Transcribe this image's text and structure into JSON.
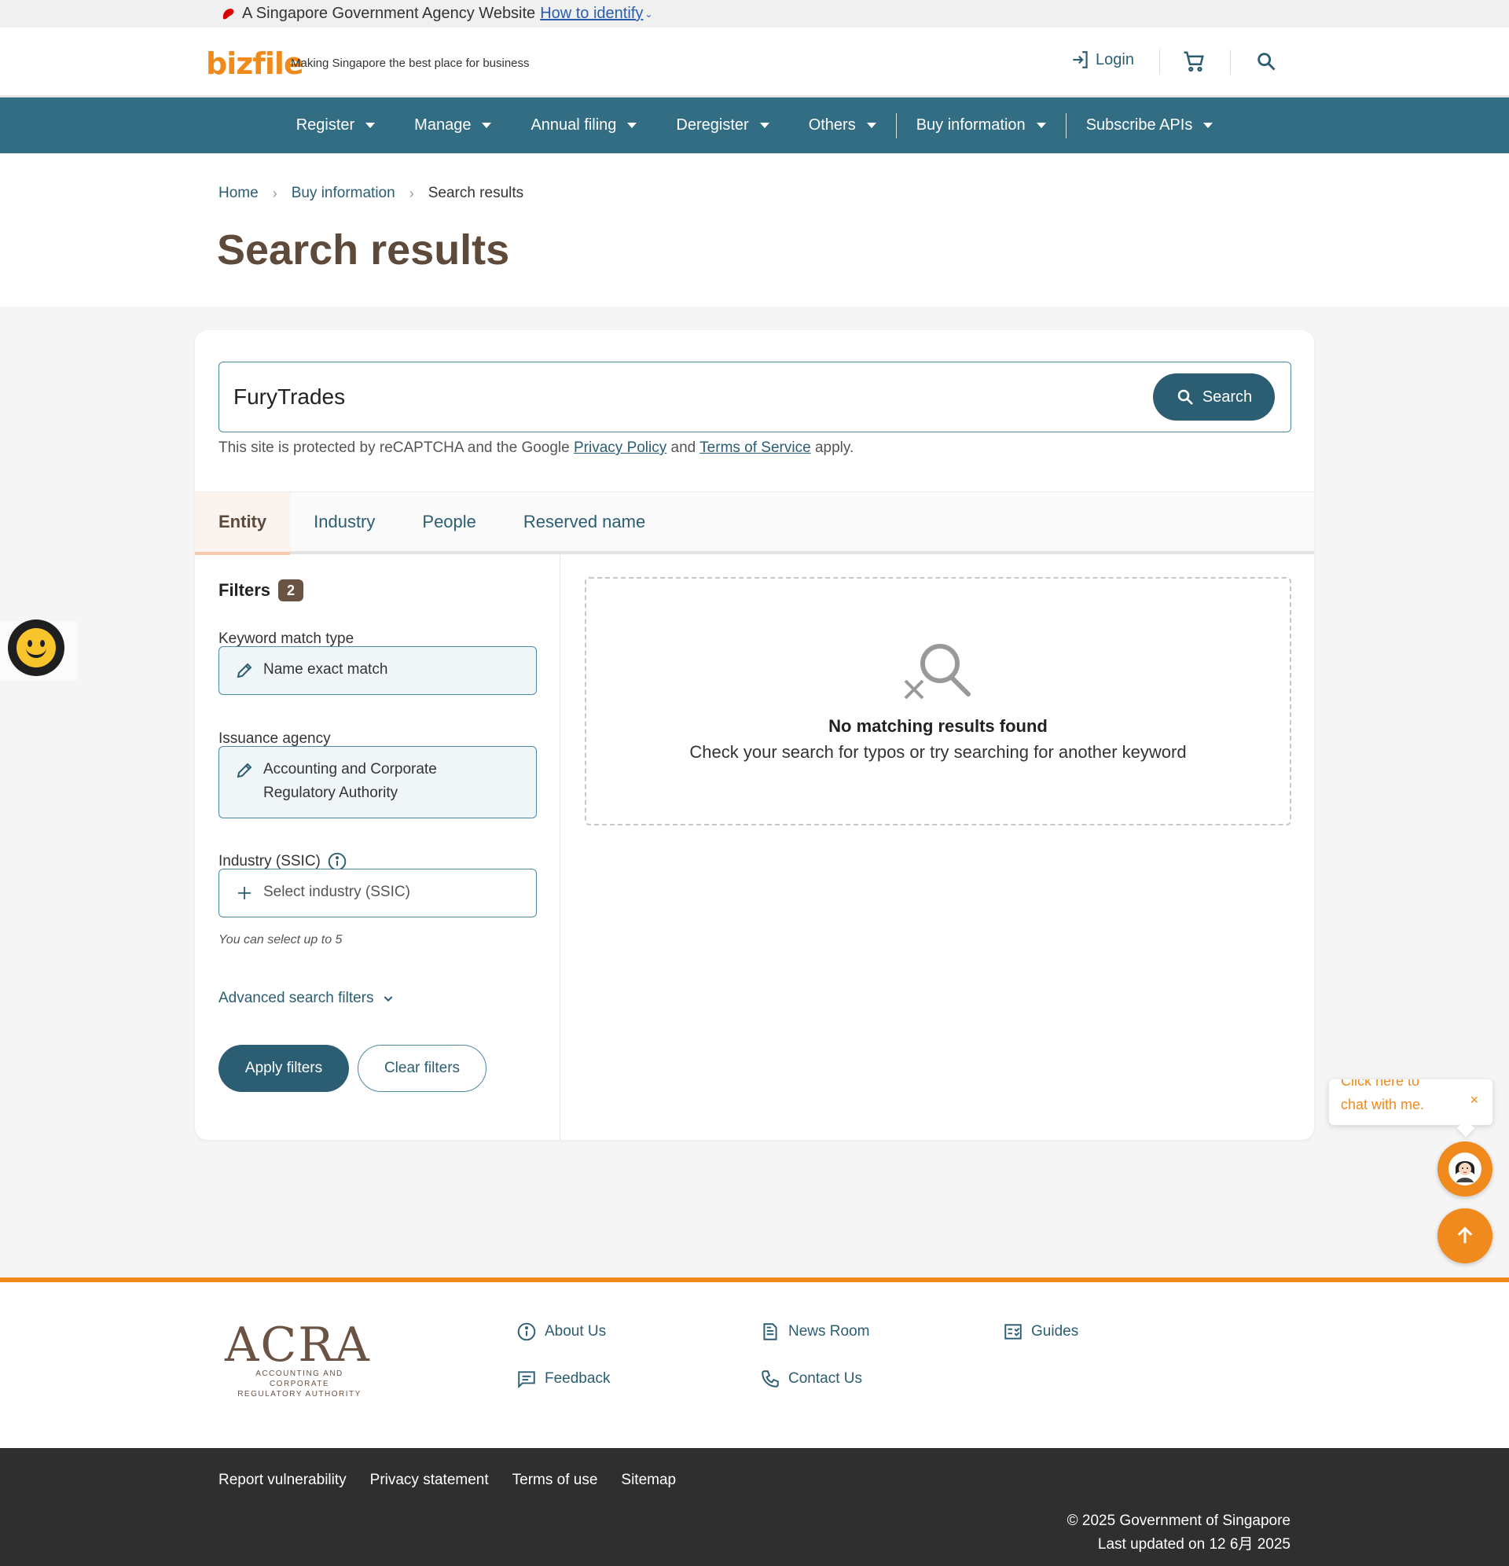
{
  "masthead": {
    "text": "A Singapore Government Agency Website",
    "link": "How to identify"
  },
  "header": {
    "logo": "bizfile",
    "tagline": "Making Singapore the best place for business",
    "login": "Login"
  },
  "nav": [
    {
      "label": "Register"
    },
    {
      "label": "Manage"
    },
    {
      "label": "Annual filing"
    },
    {
      "label": "Deregister"
    },
    {
      "label": "Others"
    },
    {
      "label": "Buy information"
    },
    {
      "label": "Subscribe APIs"
    }
  ],
  "breadcrumb": {
    "home": "Home",
    "parent": "Buy information",
    "current": "Search results"
  },
  "page_title": "Search results",
  "search": {
    "value": "FuryTrades",
    "button": "Search"
  },
  "recaptcha": {
    "prefix": "This site is protected by reCAPTCHA and the Google",
    "privacy": "Privacy Policy",
    "and": "and",
    "terms": "Terms of Service",
    "suffix": "apply."
  },
  "tabs": [
    {
      "label": "Entity",
      "active": true
    },
    {
      "label": "Industry"
    },
    {
      "label": "People"
    },
    {
      "label": "Reserved name"
    }
  ],
  "filters": {
    "title": "Filters",
    "count": "2",
    "keyword_label": "Keyword match type",
    "keyword_value": "Name exact match",
    "agency_label": "Issuance agency",
    "agency_value": "Accounting and Corporate Regulatory Authority",
    "industry_label": "Industry (SSIC)",
    "industry_placeholder": "Select industry (SSIC)",
    "industry_hint": "You can select up to 5",
    "advanced": "Advanced search filters",
    "apply": "Apply filters",
    "clear": "Clear filters"
  },
  "results": {
    "title": "No matching results found",
    "subtitle": "Check your search for typos or try searching for another keyword"
  },
  "chat": {
    "line1": "Click here to",
    "line2": "chat with me.",
    "close": "×"
  },
  "footer": {
    "logo_big": "ACRA",
    "logo_small_1": "ACCOUNTING AND CORPORATE",
    "logo_small_2": "REGULATORY AUTHORITY",
    "links": {
      "about": "About Us",
      "news": "News Room",
      "guides": "Guides",
      "feedback": "Feedback",
      "contact": "Contact Us"
    },
    "bottom_links": [
      "Report vulnerability",
      "Privacy statement",
      "Terms of use",
      "Sitemap"
    ],
    "copyright": "© 2025 Government of Singapore",
    "updated": "Last updated on 12 6月 2025"
  },
  "colors": {
    "brand": "#f08a1c",
    "nav": "#336d84",
    "primary": "#2b5d73",
    "title": "#5e4a3a"
  }
}
